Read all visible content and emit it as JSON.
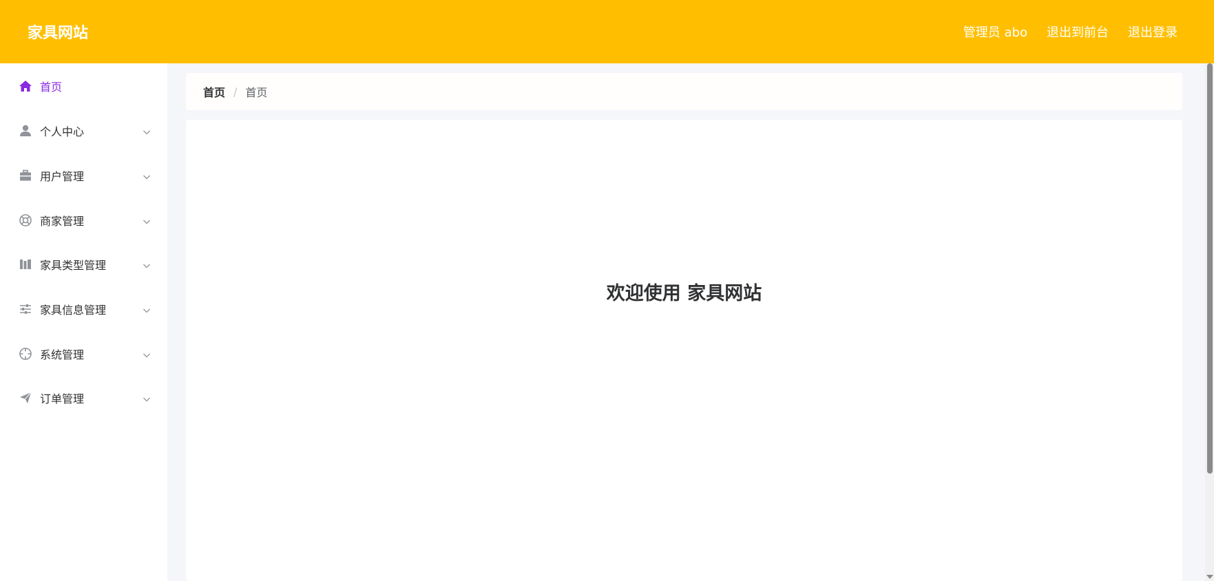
{
  "header": {
    "brand": "家具网站",
    "user_label": "管理员 abo",
    "front_link": "退出到前台",
    "logout_link": "退出登录",
    "bg_color": "#ffbf00"
  },
  "sidebar": {
    "items": [
      {
        "label": "首页",
        "icon": "home-icon",
        "active": true
      },
      {
        "label": "个人中心",
        "icon": "user-icon"
      },
      {
        "label": "用户管理",
        "icon": "briefcase-icon"
      },
      {
        "label": "商家管理",
        "icon": "lifebuoy-icon"
      },
      {
        "label": "家具类型管理",
        "icon": "library-icon"
      },
      {
        "label": "家具信息管理",
        "icon": "sliders-icon"
      },
      {
        "label": "系统管理",
        "icon": "crosshair-icon"
      },
      {
        "label": "订单管理",
        "icon": "paper-plane-icon"
      }
    ],
    "active_color": "#8a2be2"
  },
  "breadcrumb": {
    "home": "首页",
    "separator": "/",
    "current": "首页"
  },
  "main": {
    "welcome": "欢迎使用 家具网站"
  }
}
